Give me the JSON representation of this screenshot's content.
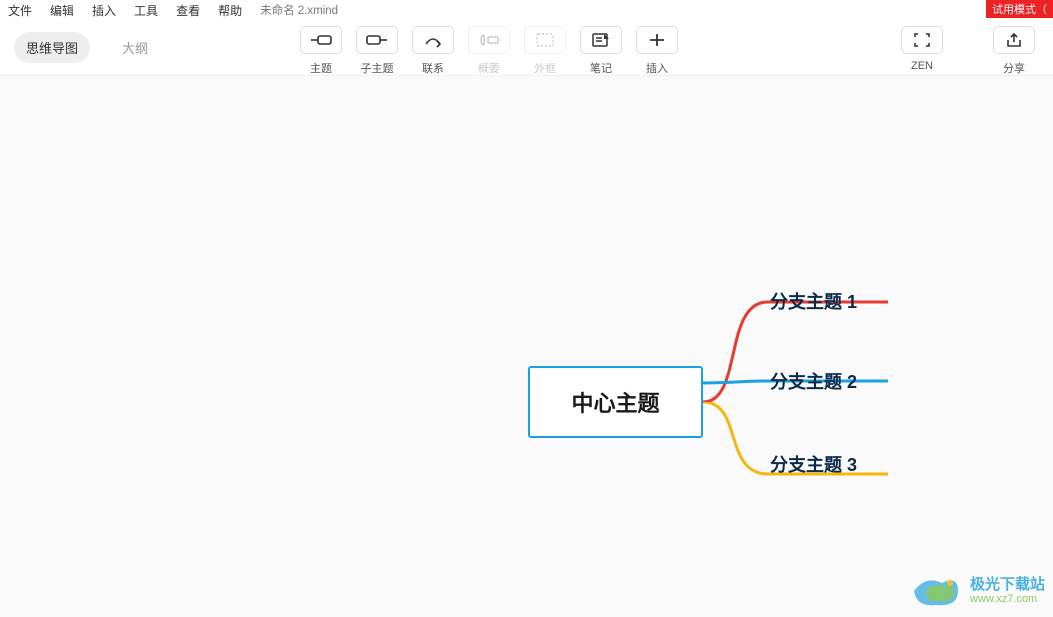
{
  "menu": {
    "file": "文件",
    "edit": "编辑",
    "insert": "插入",
    "tools": "工具",
    "view": "查看",
    "help": "帮助",
    "filename": "未命名 2.xmind"
  },
  "trial_badge": "试用模式（",
  "view_tabs": {
    "mindmap": "思维导图",
    "outline": "大纲"
  },
  "toolbar": {
    "topic": "主题",
    "subtopic": "子主题",
    "relationship": "联系",
    "summary": "概要",
    "boundary": "外框",
    "notes": "笔记",
    "insert": "插入",
    "zen": "ZEN",
    "share": "分享"
  },
  "mindmap": {
    "central": "中心主题",
    "branch1": "分支主题 1",
    "branch2": "分支主题 2",
    "branch3": "分支主题 3"
  },
  "watermark": {
    "cn": "极光下载站",
    "url": "www.xz7.com"
  }
}
